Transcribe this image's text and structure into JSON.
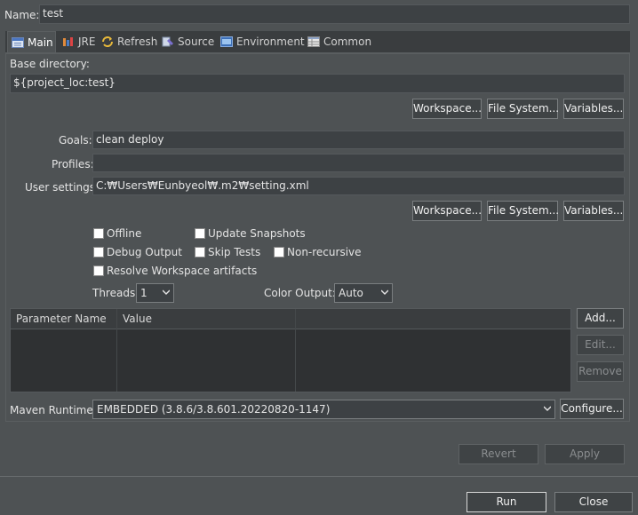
{
  "name": {
    "label": "Name:",
    "value": "test"
  },
  "tabs": [
    {
      "label": "Main",
      "icon": "main-tab-icon"
    },
    {
      "label": "JRE",
      "icon": "jre-icon"
    },
    {
      "label": "Refresh",
      "icon": "refresh-icon"
    },
    {
      "label": "Source",
      "icon": "source-icon"
    },
    {
      "label": "Environment",
      "icon": "environment-icon"
    },
    {
      "label": "Common",
      "icon": "common-icon"
    }
  ],
  "base_directory": {
    "label": "Base directory:",
    "value": "${project_loc:test}",
    "buttons": {
      "workspace": "Workspace...",
      "file_system": "File System...",
      "variables": "Variables..."
    }
  },
  "goals": {
    "label": "Goals:",
    "value": "clean deploy"
  },
  "profiles": {
    "label": "Profiles:",
    "value": ""
  },
  "user_settings": {
    "label": "User settings:",
    "value": "C:₩Users₩Eunbyeol₩.m2₩setting.xml",
    "buttons": {
      "workspace": "Workspace...",
      "file_system": "File System...",
      "variables": "Variables..."
    }
  },
  "options": {
    "offline": "Offline",
    "update_snapshots": "Update Snapshots",
    "debug_output": "Debug Output",
    "skip_tests": "Skip Tests",
    "non_recursive": "Non-recursive",
    "resolve_workspace": "Resolve Workspace artifacts"
  },
  "threads": {
    "label": "Threads:",
    "value": "1"
  },
  "color_output": {
    "label": "Color Output:",
    "value": "Auto"
  },
  "parameters": {
    "columns": [
      "Parameter Name",
      "Value"
    ],
    "buttons": {
      "add": "Add...",
      "edit": "Edit...",
      "remove": "Remove"
    }
  },
  "maven_runtime": {
    "label": "Maven Runtime:",
    "value": "EMBEDDED (3.8.6/3.8.601.20220820-1147)",
    "configure": "Configure..."
  },
  "footer": {
    "revert": "Revert",
    "apply": "Apply",
    "run": "Run",
    "close": "Close"
  }
}
